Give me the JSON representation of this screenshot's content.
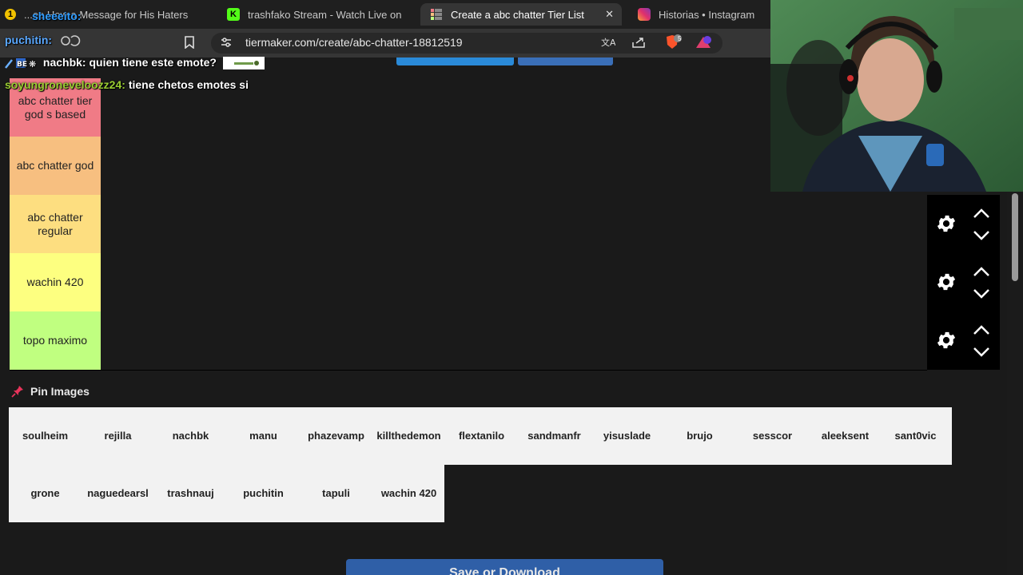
{
  "browser": {
    "tabs": [
      {
        "label": "...ee How a Message for His Haters"
      },
      {
        "label": "trashfako Stream - Watch Live on"
      },
      {
        "label": "Create a abc chatter Tier List"
      },
      {
        "label": "Historias • Instagram"
      }
    ],
    "url": "tiermaker.com/create/abc-chatter-18812519",
    "brave_badge": "5"
  },
  "chat": {
    "messages": [
      {
        "user": "sheeeito:",
        "text": "",
        "user_color": "#2f9cff"
      },
      {
        "user": "puchitin:",
        "text": "",
        "user_color": "#5aa8ff"
      },
      {
        "user": "nachbk:",
        "text": "quien tiene este emote?",
        "user_color": "#ffffff"
      },
      {
        "user": "soyungroneveloozz24:",
        "text": "tiene chetos emotes si",
        "user_color": "#9acd32"
      }
    ]
  },
  "tiers": [
    {
      "label": "abc chatter tier god s based",
      "color": "#f07b86"
    },
    {
      "label": "abc chatter god",
      "color": "#f7bf80"
    },
    {
      "label": "abc chatter regular",
      "color": "#fdde80"
    },
    {
      "label": "wachin 420",
      "color": "#fdff80"
    },
    {
      "label": "topo maximo",
      "color": "#c0ff80"
    }
  ],
  "pin_label": "Pin Images",
  "pool_items_row1": [
    "soulheim",
    "rejilla",
    "nachbk",
    "manu",
    "phazevamp",
    "killthedemon",
    "flextanilo",
    "sandmanfr",
    "yisuslade",
    "brujo",
    "sesscor",
    "aleeksent",
    "sant0vic"
  ],
  "pool_items_row2": [
    "grone",
    "naguedearsl",
    "trashnauj",
    "puchitin",
    "tapuli",
    "wachin 420"
  ],
  "save_button": "Save or Download"
}
